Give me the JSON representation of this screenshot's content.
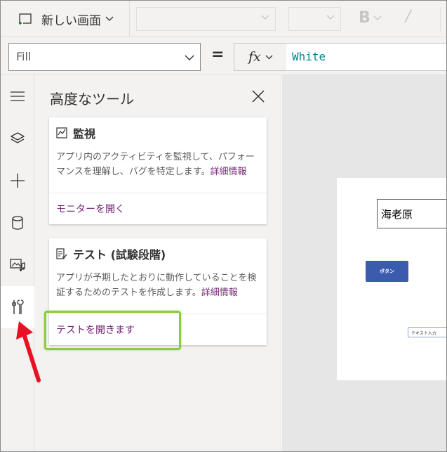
{
  "toolbar": {
    "new_screen_label": "新しい画面",
    "bold_label": "B",
    "italic_label": "/"
  },
  "formula_bar": {
    "property": "Fill",
    "equals": "=",
    "fx_label": "fx",
    "value": "White"
  },
  "rail": {
    "items": [
      {
        "icon": "hamburger-menu-icon"
      },
      {
        "icon": "layers-icon"
      },
      {
        "icon": "plus-icon"
      },
      {
        "icon": "database-icon"
      },
      {
        "icon": "media-icon"
      },
      {
        "icon": "advanced-tools-icon",
        "active": true
      }
    ]
  },
  "panel": {
    "title": "高度なツール",
    "monitor_card": {
      "title": "監視",
      "description": "アプリ内のアクティビティを監視して、パフォーマンスを理解し、バグを特定します。",
      "more_link": "詳細情報",
      "action_link": "モニターを開く"
    },
    "test_card": {
      "title": "テスト (試験段階)",
      "description": "アプリが予期したとおりに動作していることを検証するためのテストを作成します。",
      "more_link": "詳細情報",
      "action_link": "テストを開きます"
    }
  },
  "canvas": {
    "textbox_value": "海老原",
    "button_label": "ボタン",
    "text_input_placeholder": "テキスト入力"
  },
  "colors": {
    "accent_purple": "#742774",
    "highlight_green": "#8ccb3e",
    "arrow_red": "#e81123",
    "button_blue": "#3b5bac",
    "formula_teal": "#00868b"
  }
}
